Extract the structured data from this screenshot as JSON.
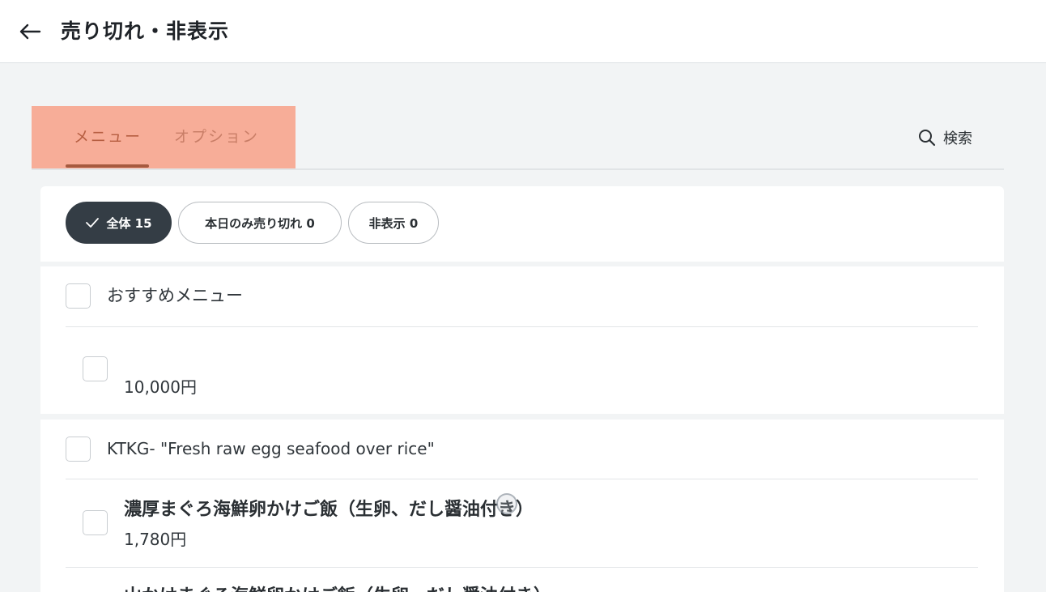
{
  "header": {
    "back_icon": "arrow-left-icon",
    "title": "売り切れ・非表示"
  },
  "tabs": {
    "items": [
      {
        "label": "メニュー",
        "active": true
      },
      {
        "label": "オプション",
        "active": false
      }
    ],
    "highlight_color": "#f7ad98",
    "active_color": "#a65a3f"
  },
  "search": {
    "icon": "search-icon",
    "label": "検索"
  },
  "filters": {
    "all_label": "全体 15",
    "all_icon": "check-icon",
    "soldout_today_label": "本日のみ売り切れ 0",
    "hidden_label": "非表示 0",
    "active_color": "#343d45"
  },
  "categories": [
    {
      "name": "おすすめメニュー",
      "items": [
        {
          "name": "",
          "price": "10,000円"
        }
      ]
    },
    {
      "name": "KTKG- \"Fresh raw egg seafood over rice\"",
      "items": [
        {
          "name": "濃厚まぐろ海鮮卵かけご飯（生卵、だし醤油付き）",
          "price": "1,780円"
        },
        {
          "name": "山かけまぐろ海鮮卵かけご飯（生卵、だし醤油付き）",
          "price": ""
        }
      ]
    }
  ]
}
